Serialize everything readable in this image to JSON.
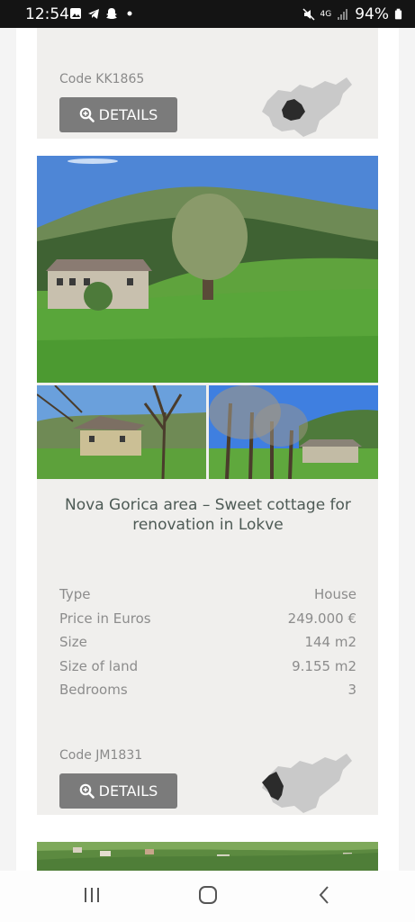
{
  "status_bar": {
    "time": "12:54",
    "battery": "94%",
    "network": "4G"
  },
  "listings": [
    {
      "code": "Code KK1865",
      "details_label": "DETAILS"
    },
    {
      "title": "Nova Gorica area – Sweet cottage for renovation in Lokve",
      "specs": [
        {
          "label": "Type",
          "value": "House"
        },
        {
          "label": "Price in Euros",
          "value": "249.000 €"
        },
        {
          "label": "Size",
          "value": "144 m2"
        },
        {
          "label": "Size of land",
          "value": "9.155 m2"
        },
        {
          "label": "Bedrooms",
          "value": "3"
        }
      ],
      "code": "Code JM1831",
      "details_label": "DETAILS"
    }
  ],
  "colors": {
    "card_bg": "#f0efed",
    "button_bg": "#7b7b7b",
    "map_highlight": "#2b2b2b",
    "map_base": "#c9c9c9"
  },
  "icons": {
    "details": "magnify-plus-icon",
    "nav_recent": "recent-apps-icon",
    "nav_home": "home-icon",
    "nav_back": "back-icon"
  }
}
